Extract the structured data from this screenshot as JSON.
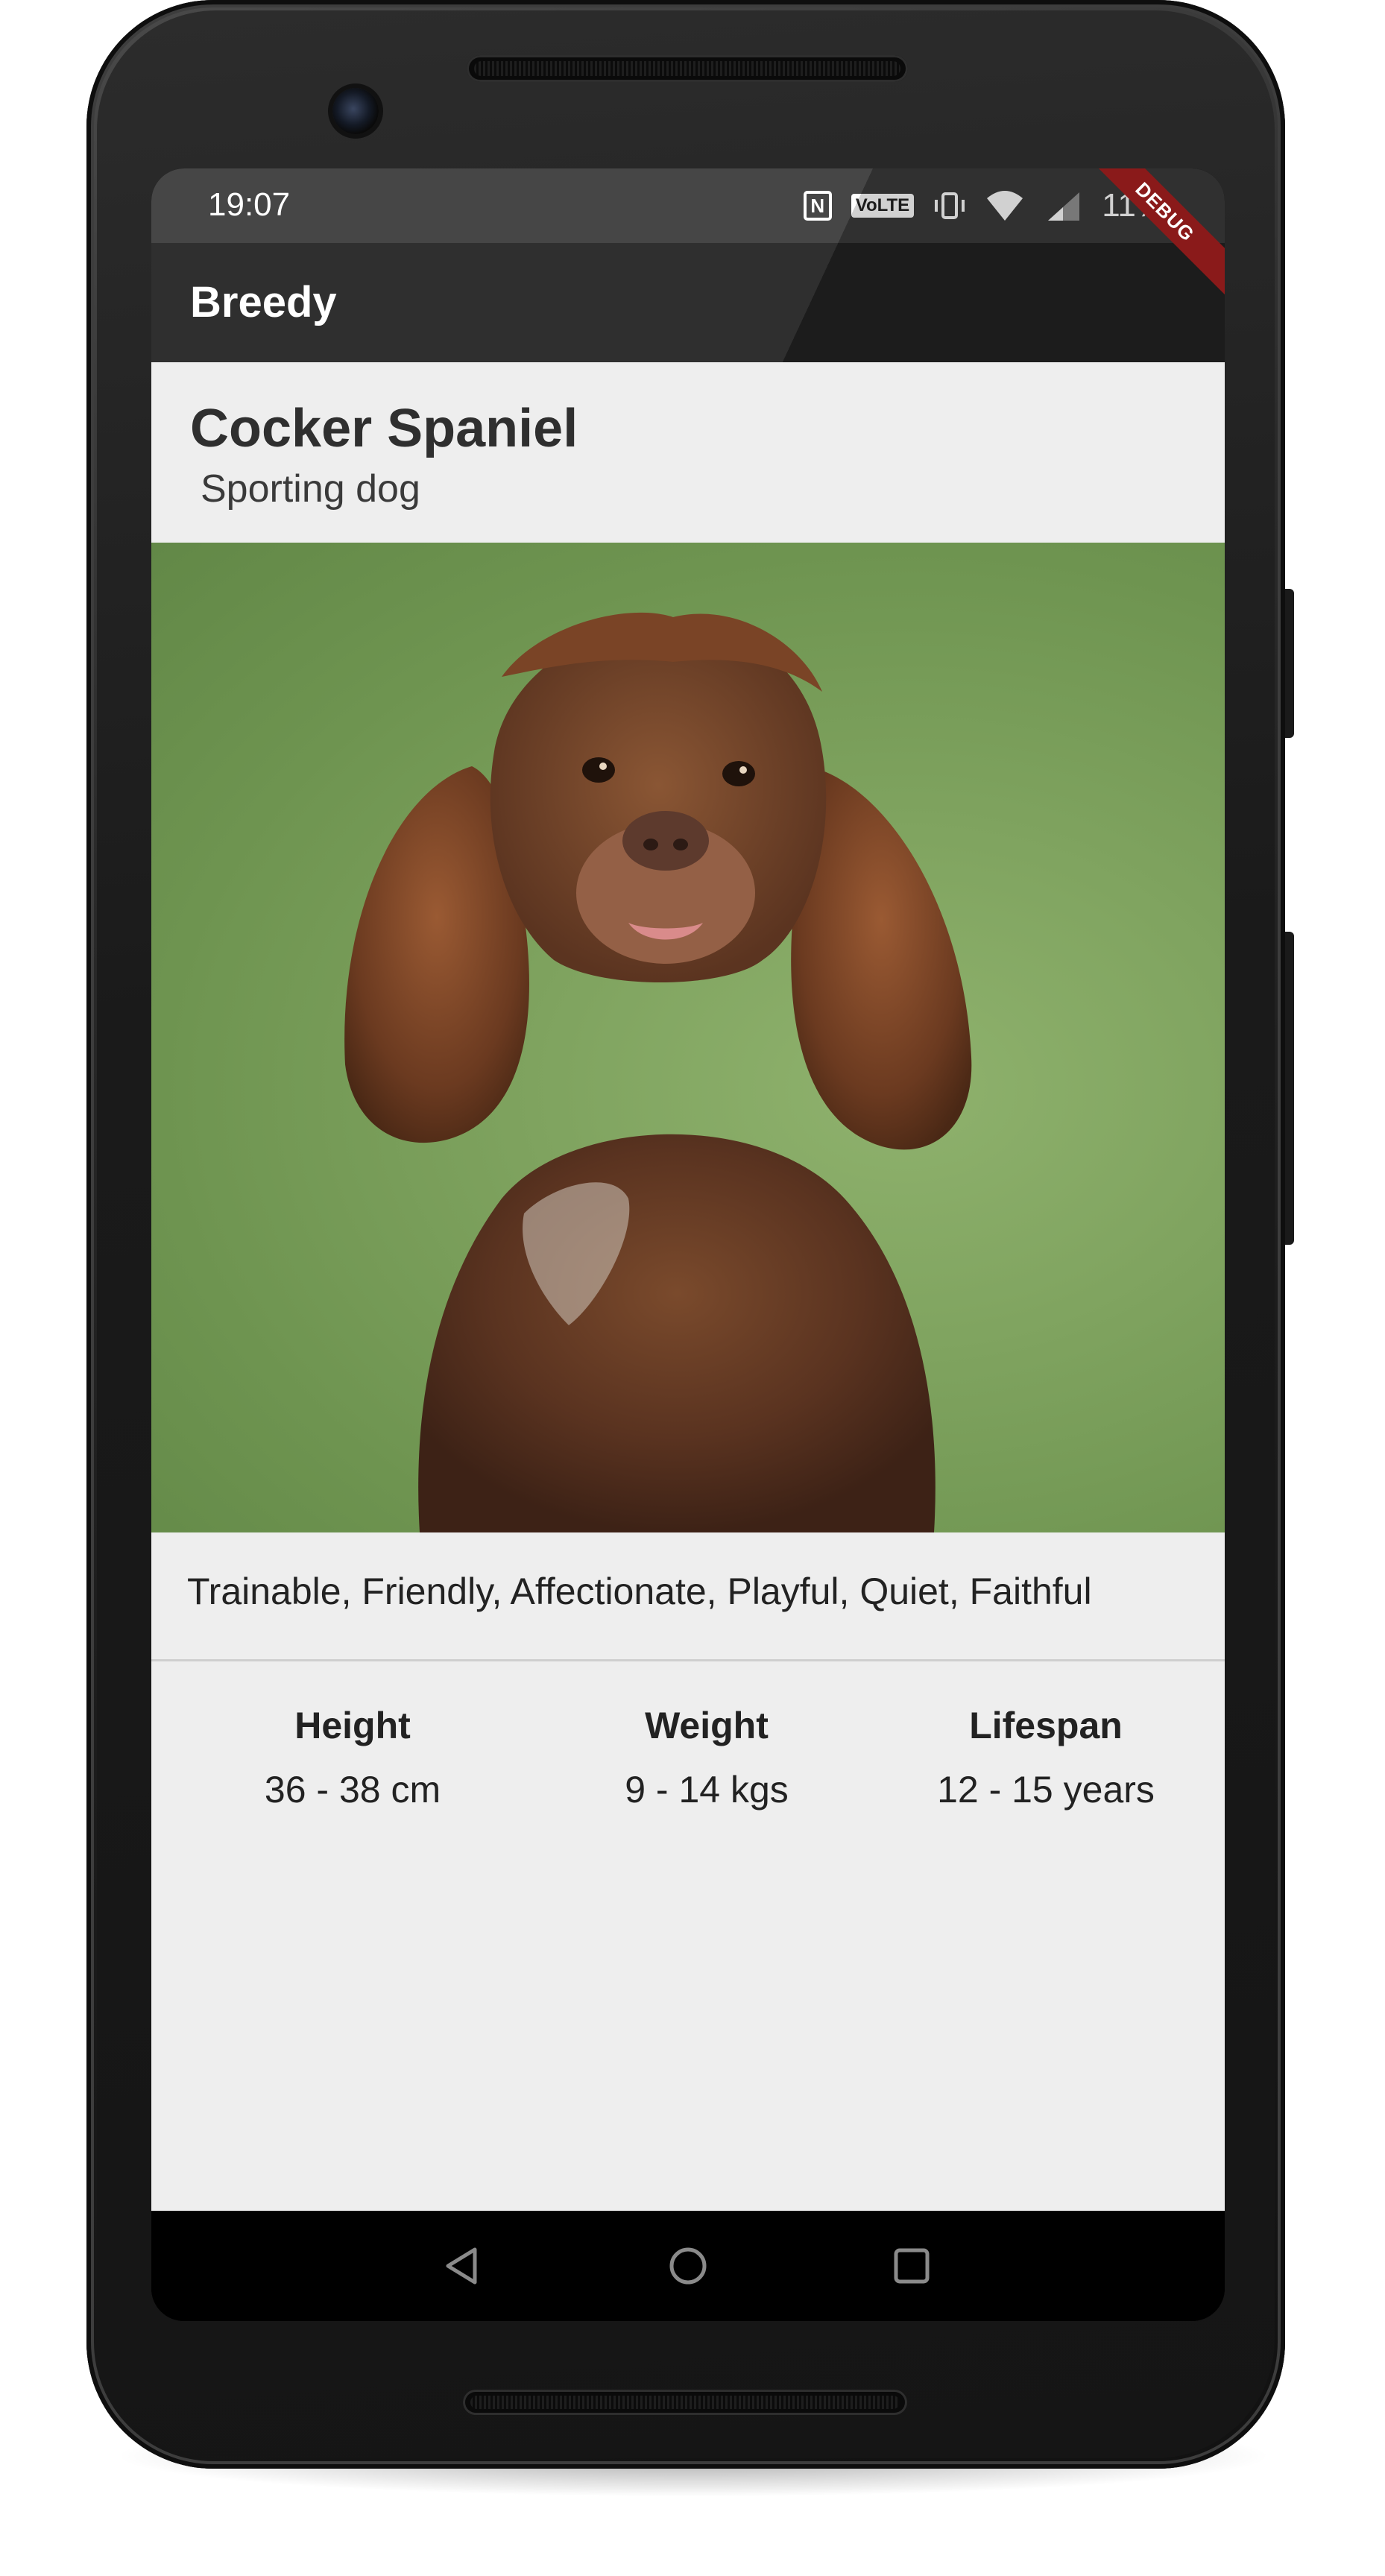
{
  "status_bar": {
    "time": "19:07",
    "battery": "11%",
    "icons": [
      "nfc-icon",
      "volte-icon",
      "vibrate-icon",
      "wifi-icon",
      "signal-icon"
    ],
    "volte_label": "VoLTE",
    "nfc_label": "N"
  },
  "app_bar": {
    "title": "Breedy",
    "debug_label": "DEBUG"
  },
  "breed": {
    "name": "Cocker Spaniel",
    "group": "Sporting dog",
    "temperament": "Trainable, Friendly, Affectionate, Playful, Quiet, Faithful",
    "stats": [
      {
        "label": "Height",
        "value": "36 - 38 cm"
      },
      {
        "label": "Weight",
        "value": "9 - 14 kgs"
      },
      {
        "label": "Lifespan",
        "value": "12 - 15 years"
      }
    ]
  },
  "navigation": {
    "buttons": [
      "back-icon",
      "home-icon",
      "recents-icon"
    ]
  },
  "colors": {
    "app_bar": "#222222",
    "status_bar": "#3a3a3a",
    "content_bg": "#eeeeee",
    "photo_bg": "#7fa35f",
    "debug_banner": "#8a1a1a"
  }
}
